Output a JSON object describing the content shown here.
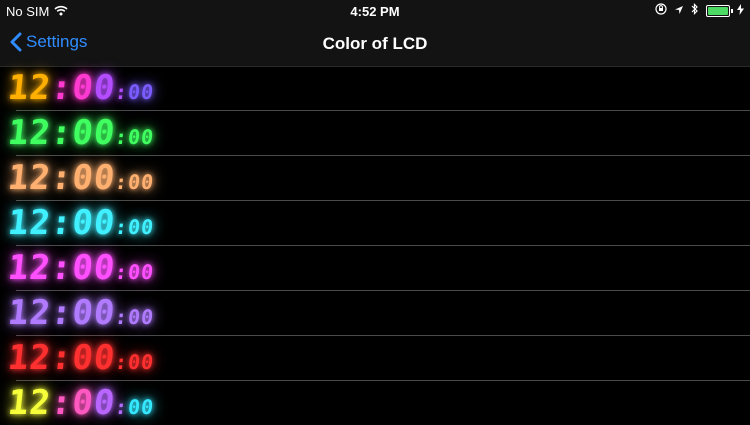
{
  "status": {
    "carrier": "No SIM",
    "time": "4:52 PM"
  },
  "nav": {
    "back_label": "Settings",
    "title": "Color of LCD"
  },
  "colors": [
    {
      "id": "rainbow-1",
      "big": "12:00",
      "small": "00",
      "colors": [
        "#ffb000",
        "#ff3ad0",
        "#b44dff",
        "#7a5cff"
      ]
    },
    {
      "id": "green",
      "big": "12:00",
      "small": "00",
      "colors": [
        "#40ff60"
      ]
    },
    {
      "id": "orange",
      "big": "12:00",
      "small": "00",
      "colors": [
        "#ffb070"
      ]
    },
    {
      "id": "cyan",
      "big": "12:00",
      "small": "00",
      "colors": [
        "#40f0ff"
      ]
    },
    {
      "id": "magenta",
      "big": "12:00",
      "small": "00",
      "colors": [
        "#ff50ff"
      ]
    },
    {
      "id": "violet",
      "big": "12:00",
      "small": "00",
      "colors": [
        "#b07bff"
      ]
    },
    {
      "id": "red",
      "big": "12:00",
      "small": "00",
      "colors": [
        "#ff3030"
      ]
    },
    {
      "id": "rainbow-2",
      "big": "12:00",
      "small": "00",
      "colors": [
        "#f6ff3a",
        "#ff58c0",
        "#b866ff",
        "#35e8ff"
      ]
    }
  ]
}
